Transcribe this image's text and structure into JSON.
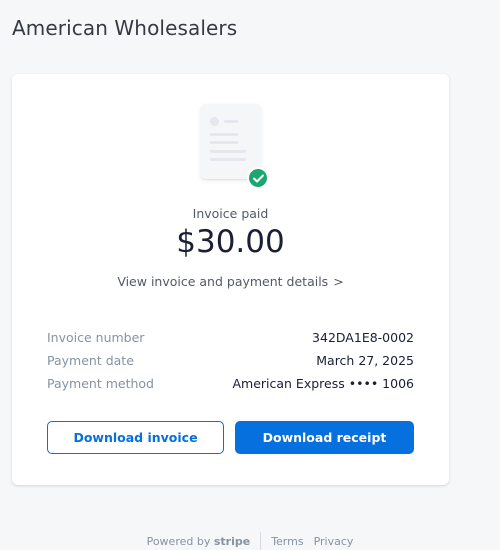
{
  "merchant": {
    "name": "American Wholesalers"
  },
  "invoice": {
    "status": "Invoice paid",
    "amount": "$30.00",
    "view_link": "View invoice and payment details",
    "view_link_chevron": ">"
  },
  "details": {
    "rows": [
      {
        "label": "Invoice number",
        "value": "342DA1E8-0002"
      },
      {
        "label": "Payment date",
        "value": "March 27, 2025"
      },
      {
        "label": "Payment method",
        "value": "American Express •••• 1006"
      }
    ]
  },
  "buttons": {
    "download_invoice": "Download invoice",
    "download_receipt": "Download receipt"
  },
  "footer": {
    "powered_by": "Powered by",
    "brand": "stripe",
    "terms": "Terms",
    "privacy": "Privacy"
  },
  "colors": {
    "accent": "#0570de",
    "success": "#1ea672",
    "background": "#f6f7f9"
  },
  "icons": {
    "illustration": "invoice-document-icon",
    "badge": "checkmark-icon",
    "chevron": "chevron-right-icon"
  }
}
